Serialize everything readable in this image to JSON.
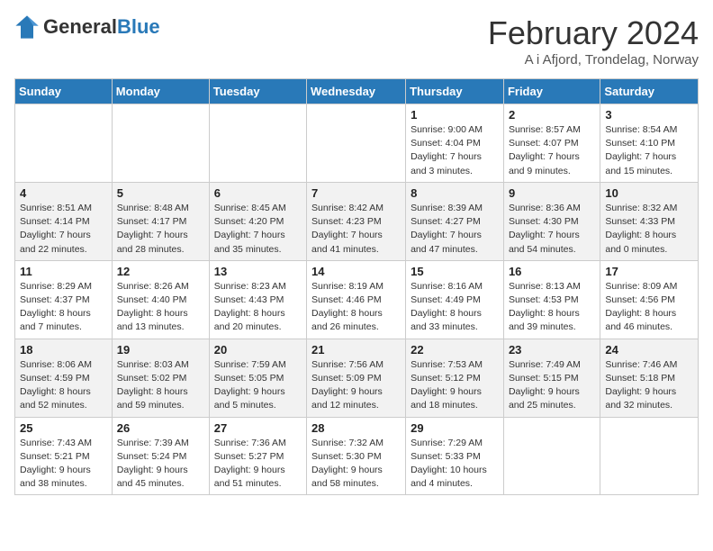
{
  "header": {
    "logo_general": "General",
    "logo_blue": "Blue",
    "title": "February 2024",
    "subtitle": "A i Afjord, Trondelag, Norway"
  },
  "days_of_week": [
    "Sunday",
    "Monday",
    "Tuesday",
    "Wednesday",
    "Thursday",
    "Friday",
    "Saturday"
  ],
  "weeks": [
    [
      {
        "day": "",
        "info": ""
      },
      {
        "day": "",
        "info": ""
      },
      {
        "day": "",
        "info": ""
      },
      {
        "day": "",
        "info": ""
      },
      {
        "day": "1",
        "info": "Sunrise: 9:00 AM\nSunset: 4:04 PM\nDaylight: 7 hours\nand 3 minutes."
      },
      {
        "day": "2",
        "info": "Sunrise: 8:57 AM\nSunset: 4:07 PM\nDaylight: 7 hours\nand 9 minutes."
      },
      {
        "day": "3",
        "info": "Sunrise: 8:54 AM\nSunset: 4:10 PM\nDaylight: 7 hours\nand 15 minutes."
      }
    ],
    [
      {
        "day": "4",
        "info": "Sunrise: 8:51 AM\nSunset: 4:14 PM\nDaylight: 7 hours\nand 22 minutes."
      },
      {
        "day": "5",
        "info": "Sunrise: 8:48 AM\nSunset: 4:17 PM\nDaylight: 7 hours\nand 28 minutes."
      },
      {
        "day": "6",
        "info": "Sunrise: 8:45 AM\nSunset: 4:20 PM\nDaylight: 7 hours\nand 35 minutes."
      },
      {
        "day": "7",
        "info": "Sunrise: 8:42 AM\nSunset: 4:23 PM\nDaylight: 7 hours\nand 41 minutes."
      },
      {
        "day": "8",
        "info": "Sunrise: 8:39 AM\nSunset: 4:27 PM\nDaylight: 7 hours\nand 47 minutes."
      },
      {
        "day": "9",
        "info": "Sunrise: 8:36 AM\nSunset: 4:30 PM\nDaylight: 7 hours\nand 54 minutes."
      },
      {
        "day": "10",
        "info": "Sunrise: 8:32 AM\nSunset: 4:33 PM\nDaylight: 8 hours\nand 0 minutes."
      }
    ],
    [
      {
        "day": "11",
        "info": "Sunrise: 8:29 AM\nSunset: 4:37 PM\nDaylight: 8 hours\nand 7 minutes."
      },
      {
        "day": "12",
        "info": "Sunrise: 8:26 AM\nSunset: 4:40 PM\nDaylight: 8 hours\nand 13 minutes."
      },
      {
        "day": "13",
        "info": "Sunrise: 8:23 AM\nSunset: 4:43 PM\nDaylight: 8 hours\nand 20 minutes."
      },
      {
        "day": "14",
        "info": "Sunrise: 8:19 AM\nSunset: 4:46 PM\nDaylight: 8 hours\nand 26 minutes."
      },
      {
        "day": "15",
        "info": "Sunrise: 8:16 AM\nSunset: 4:49 PM\nDaylight: 8 hours\nand 33 minutes."
      },
      {
        "day": "16",
        "info": "Sunrise: 8:13 AM\nSunset: 4:53 PM\nDaylight: 8 hours\nand 39 minutes."
      },
      {
        "day": "17",
        "info": "Sunrise: 8:09 AM\nSunset: 4:56 PM\nDaylight: 8 hours\nand 46 minutes."
      }
    ],
    [
      {
        "day": "18",
        "info": "Sunrise: 8:06 AM\nSunset: 4:59 PM\nDaylight: 8 hours\nand 52 minutes."
      },
      {
        "day": "19",
        "info": "Sunrise: 8:03 AM\nSunset: 5:02 PM\nDaylight: 8 hours\nand 59 minutes."
      },
      {
        "day": "20",
        "info": "Sunrise: 7:59 AM\nSunset: 5:05 PM\nDaylight: 9 hours\nand 5 minutes."
      },
      {
        "day": "21",
        "info": "Sunrise: 7:56 AM\nSunset: 5:09 PM\nDaylight: 9 hours\nand 12 minutes."
      },
      {
        "day": "22",
        "info": "Sunrise: 7:53 AM\nSunset: 5:12 PM\nDaylight: 9 hours\nand 18 minutes."
      },
      {
        "day": "23",
        "info": "Sunrise: 7:49 AM\nSunset: 5:15 PM\nDaylight: 9 hours\nand 25 minutes."
      },
      {
        "day": "24",
        "info": "Sunrise: 7:46 AM\nSunset: 5:18 PM\nDaylight: 9 hours\nand 32 minutes."
      }
    ],
    [
      {
        "day": "25",
        "info": "Sunrise: 7:43 AM\nSunset: 5:21 PM\nDaylight: 9 hours\nand 38 minutes."
      },
      {
        "day": "26",
        "info": "Sunrise: 7:39 AM\nSunset: 5:24 PM\nDaylight: 9 hours\nand 45 minutes."
      },
      {
        "day": "27",
        "info": "Sunrise: 7:36 AM\nSunset: 5:27 PM\nDaylight: 9 hours\nand 51 minutes."
      },
      {
        "day": "28",
        "info": "Sunrise: 7:32 AM\nSunset: 5:30 PM\nDaylight: 9 hours\nand 58 minutes."
      },
      {
        "day": "29",
        "info": "Sunrise: 7:29 AM\nSunset: 5:33 PM\nDaylight: 10 hours\nand 4 minutes."
      },
      {
        "day": "",
        "info": ""
      },
      {
        "day": "",
        "info": ""
      }
    ]
  ]
}
